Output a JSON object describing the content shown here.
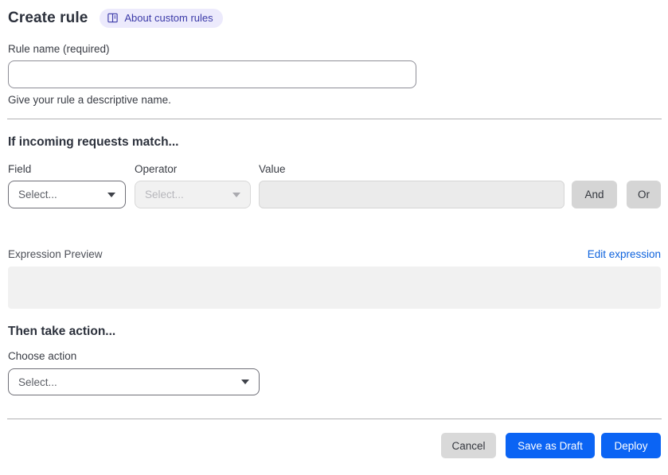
{
  "colors": {
    "primary_blue": "#0b64f4",
    "link_blue": "#0d62dd",
    "badge_bg": "#eceafc",
    "badge_text": "#3b3aa8",
    "disabled_bg": "#f1f1f1",
    "gray_button_bg": "#d5d5d5"
  },
  "icons": {
    "about_badge": "book-icon",
    "select_caret": "chevron-down-icon"
  },
  "header": {
    "title": "Create rule",
    "about_badge_label": "About custom rules"
  },
  "rule_name": {
    "label": "Rule name (required)",
    "value": "",
    "placeholder": "",
    "help": "Give your rule a descriptive name."
  },
  "match_section": {
    "heading": "If incoming requests match...",
    "field": {
      "label": "Field",
      "selected": "Select...",
      "enabled": true
    },
    "operator": {
      "label": "Operator",
      "selected": "Select...",
      "enabled": false
    },
    "value": {
      "label": "Value",
      "value": "",
      "enabled": false
    },
    "and_button": "And",
    "or_button": "Or",
    "expression_preview_label": "Expression Preview",
    "edit_expression_link": "Edit expression",
    "expression_value": ""
  },
  "action_section": {
    "heading": "Then take action...",
    "choose_action_label": "Choose action",
    "action_select": {
      "selected": "Select...",
      "enabled": true
    }
  },
  "footer": {
    "cancel_label": "Cancel",
    "save_draft_label": "Save as Draft",
    "deploy_label": "Deploy"
  }
}
